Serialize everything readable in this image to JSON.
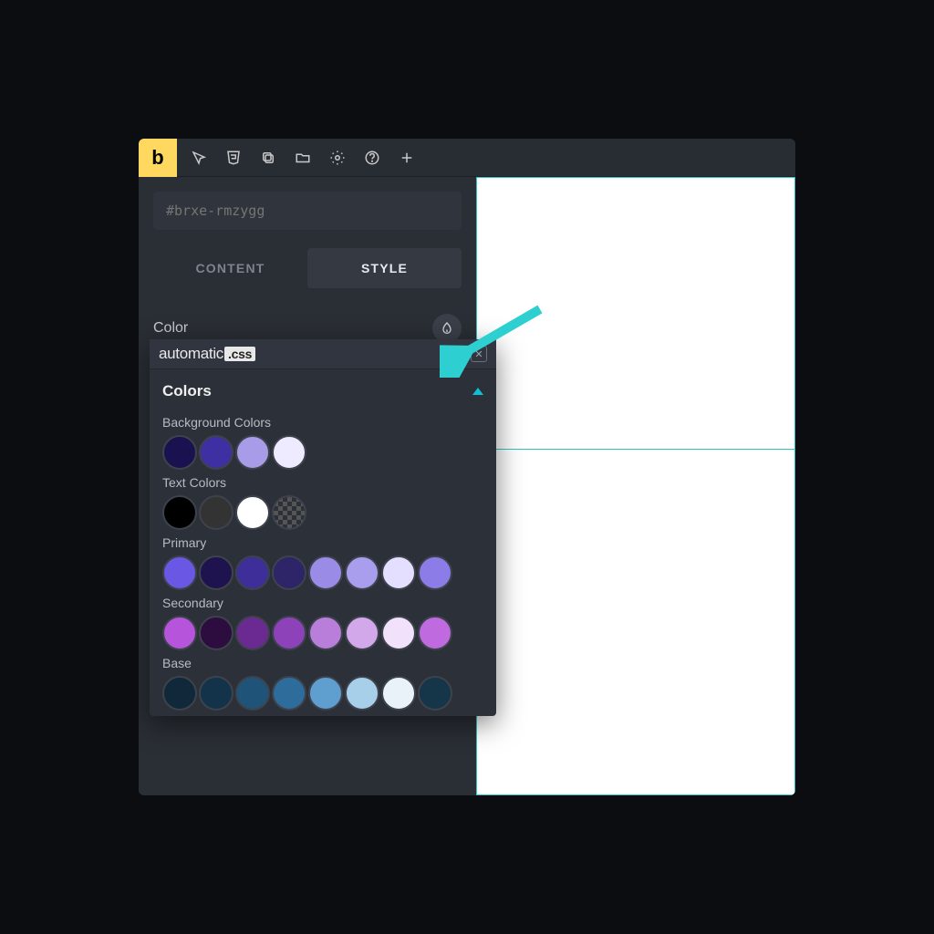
{
  "app": {
    "logo": "b"
  },
  "selector": {
    "placeholder": "#brxe-rmzygg"
  },
  "tabs": {
    "content": "CONTENT",
    "style": "STYLE"
  },
  "color_section": {
    "label": "Color"
  },
  "popup": {
    "brand": "automatic",
    "brand_tag": ".css",
    "section_title": "Colors",
    "groups": [
      {
        "label": "Background Colors",
        "colors": [
          "#1a1250",
          "#3e2fa3",
          "#a89be8",
          "#eeeaff"
        ]
      },
      {
        "label": "Text Colors",
        "colors": [
          "#000000",
          "#333333",
          "#ffffff",
          "checker"
        ]
      },
      {
        "label": "Primary",
        "colors": [
          "#6a57e3",
          "#1f134f",
          "#3d2e9a",
          "#2e2468",
          "#998be6",
          "#a99ded",
          "#e4dfff",
          "#8c7ce8"
        ]
      },
      {
        "label": "Secondary",
        "colors": [
          "#b655dc",
          "#2d0d3f",
          "#6b2a92",
          "#8d42ba",
          "#b87ed9",
          "#d3a8ea",
          "#f1e1fa",
          "#c06ae0"
        ]
      },
      {
        "label": "Base",
        "colors": [
          "#10283a",
          "#13334a",
          "#1f5378",
          "#2e6c9c",
          "#5f9fd0",
          "#a8cfe9",
          "#e9f2f8",
          "#153648"
        ]
      }
    ]
  }
}
